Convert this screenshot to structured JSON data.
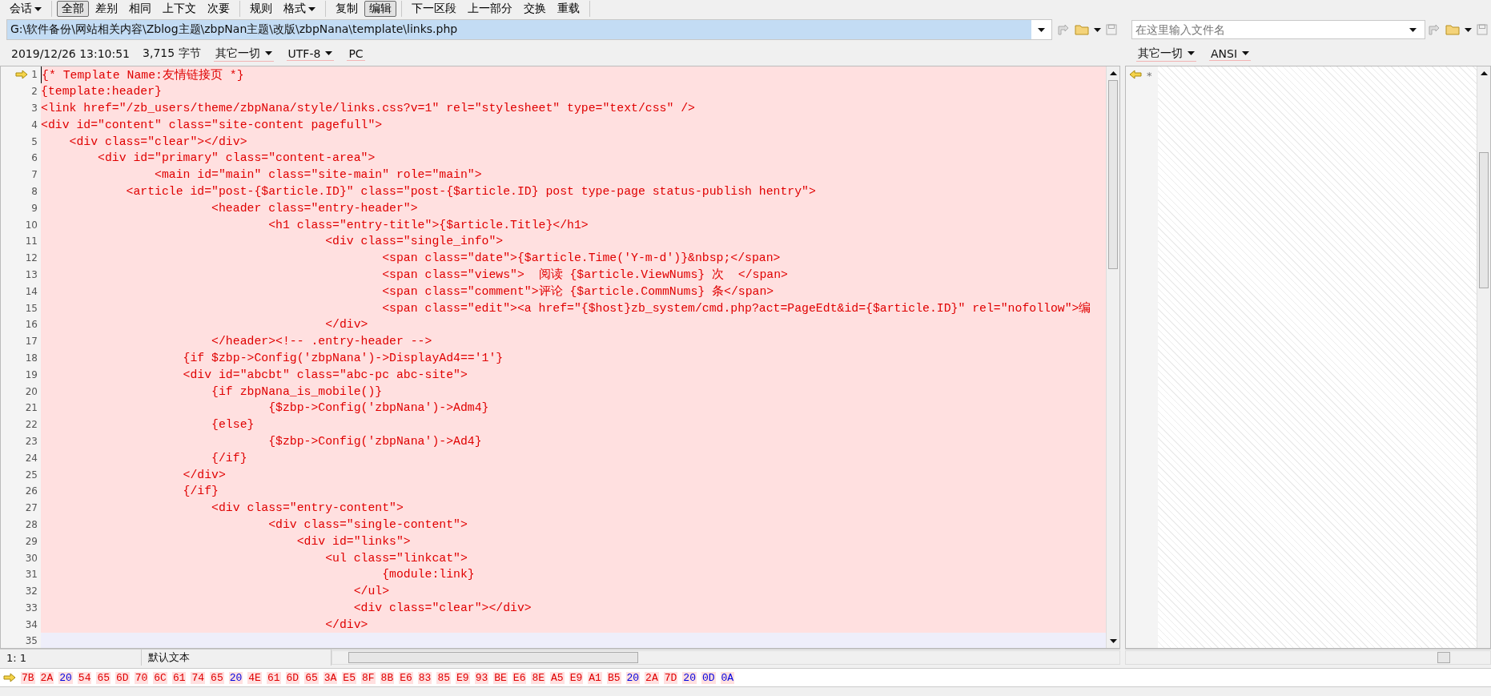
{
  "toolbar": {
    "groups": [
      [
        {
          "label": "会话",
          "pressed": false,
          "dropdown": true
        }
      ],
      [
        {
          "label": "全部",
          "pressed": true,
          "dropdown": false
        },
        {
          "label": "差别",
          "pressed": false,
          "dropdown": false
        },
        {
          "label": "相同",
          "pressed": false,
          "dropdown": false
        },
        {
          "label": "上下文",
          "pressed": false,
          "dropdown": false
        },
        {
          "label": "次要",
          "pressed": false,
          "dropdown": false
        }
      ],
      [
        {
          "label": "规则",
          "pressed": false,
          "dropdown": false
        },
        {
          "label": "格式",
          "pressed": false,
          "dropdown": true
        }
      ],
      [
        {
          "label": "复制",
          "pressed": false,
          "dropdown": false
        },
        {
          "label": "编辑",
          "pressed": true,
          "dropdown": false
        }
      ],
      [
        {
          "label": "下一区段",
          "pressed": false,
          "dropdown": false
        },
        {
          "label": "上一部分",
          "pressed": false,
          "dropdown": false
        },
        {
          "label": "交换",
          "pressed": false,
          "dropdown": false
        },
        {
          "label": "重载",
          "pressed": false,
          "dropdown": false
        }
      ]
    ]
  },
  "left": {
    "path": "G:\\软件备份\\网站相关内容\\Zblog主题\\zbpNan主题\\改版\\zbpNana\\template\\links.php",
    "timestamp": "2019/12/26 13:10:51",
    "size": "3,715 字节",
    "format": "其它一切",
    "encoding": "UTF-8",
    "line_ending": "PC",
    "lines": [
      {
        "number": "1",
        "text": "{* Template Name:友情链接页 *}",
        "kind": "changed",
        "current": true
      },
      {
        "number": "2",
        "text": "{template:header}",
        "kind": "changed",
        "current": false
      },
      {
        "number": "3",
        "text": "<link href=\"/zb_users/theme/zbpNana/style/links.css?v=1\" rel=\"stylesheet\" type=\"text/css\" />",
        "kind": "changed",
        "current": false
      },
      {
        "number": "4",
        "text": "<div id=\"content\" class=\"site-content pagefull\">",
        "kind": "changed",
        "current": false
      },
      {
        "number": "5",
        "text": "    <div class=\"clear\"></div>",
        "kind": "changed",
        "current": false
      },
      {
        "number": "6",
        "text": "        <div id=\"primary\" class=\"content-area\">",
        "kind": "changed",
        "current": false
      },
      {
        "number": "7",
        "text": "                <main id=\"main\" class=\"site-main\" role=\"main\">",
        "kind": "changed",
        "current": false
      },
      {
        "number": "8",
        "text": "            <article id=\"post-{$article.ID}\" class=\"post-{$article.ID} post type-page status-publish hentry\">",
        "kind": "changed",
        "current": false
      },
      {
        "number": "9",
        "text": "                        <header class=\"entry-header\">",
        "kind": "changed",
        "current": false
      },
      {
        "number": "10",
        "text": "                                <h1 class=\"entry-title\">{$article.Title}</h1>",
        "kind": "changed",
        "current": false
      },
      {
        "number": "11",
        "text": "                                        <div class=\"single_info\">",
        "kind": "changed",
        "current": false
      },
      {
        "number": "12",
        "text": "                                                <span class=\"date\">{$article.Time('Y-m-d')}&nbsp;</span>",
        "kind": "changed",
        "current": false
      },
      {
        "number": "13",
        "text": "                                                <span class=\"views\">  阅读 {$article.ViewNums} 次  </span>",
        "kind": "changed",
        "current": false
      },
      {
        "number": "14",
        "text": "                                                <span class=\"comment\">评论 {$article.CommNums} 条</span>",
        "kind": "changed",
        "current": false
      },
      {
        "number": "15",
        "text": "                                                <span class=\"edit\"><a href=\"{$host}zb_system/cmd.php?act=PageEdt&id={$article.ID}\" rel=\"nofollow\">编",
        "kind": "changed",
        "current": false
      },
      {
        "number": "16",
        "text": "                                        </div>",
        "kind": "changed",
        "current": false
      },
      {
        "number": "17",
        "text": "                        </header><!-- .entry-header -->",
        "kind": "changed",
        "current": false
      },
      {
        "number": "18",
        "text": "                    {if $zbp->Config('zbpNana')->DisplayAd4=='1'}",
        "kind": "changed",
        "current": false
      },
      {
        "number": "19",
        "text": "                    <div id=\"abcbt\" class=\"abc-pc abc-site\">",
        "kind": "changed",
        "current": false
      },
      {
        "number": "20",
        "text": "                        {if zbpNana_is_mobile()}",
        "kind": "changed",
        "current": false
      },
      {
        "number": "21",
        "text": "                                {$zbp->Config('zbpNana')->Adm4}",
        "kind": "changed",
        "current": false
      },
      {
        "number": "22",
        "text": "                        {else}",
        "kind": "changed",
        "current": false
      },
      {
        "number": "23",
        "text": "                                {$zbp->Config('zbpNana')->Ad4}",
        "kind": "changed",
        "current": false
      },
      {
        "number": "24",
        "text": "                        {/if}",
        "kind": "changed",
        "current": false
      },
      {
        "number": "25",
        "text": "                    </div>",
        "kind": "changed",
        "current": false
      },
      {
        "number": "26",
        "text": "                    {/if}",
        "kind": "changed",
        "current": false
      },
      {
        "number": "27",
        "text": "                        <div class=\"entry-content\">",
        "kind": "changed",
        "current": false
      },
      {
        "number": "28",
        "text": "                                <div class=\"single-content\">",
        "kind": "changed",
        "current": false
      },
      {
        "number": "29",
        "text": "                                    <div id=\"links\">",
        "kind": "changed",
        "current": false
      },
      {
        "number": "30",
        "text": "                                        <ul class=\"linkcat\">",
        "kind": "changed",
        "current": false
      },
      {
        "number": "31",
        "text": "                                                {module:link}",
        "kind": "changed",
        "current": false
      },
      {
        "number": "32",
        "text": "                                            </ul>",
        "kind": "changed",
        "current": false
      },
      {
        "number": "33",
        "text": "                                            <div class=\"clear\"></div>",
        "kind": "changed",
        "current": false
      },
      {
        "number": "34",
        "text": "                                        </div>",
        "kind": "changed",
        "current": false
      },
      {
        "number": "35",
        "kind": "blank",
        "current": false
      }
    ],
    "cursor_position": "1: 1",
    "syntax": "默认文本"
  },
  "right": {
    "placeholder": "在这里输入文件名",
    "format": "其它一切",
    "encoding": "ANSI",
    "marker": "*"
  },
  "hex_bytes": [
    {
      "text": "7B",
      "kind": "text"
    },
    {
      "text": "2A",
      "kind": "text"
    },
    {
      "text": "20",
      "kind": "whitespace"
    },
    {
      "text": "54",
      "kind": "text"
    },
    {
      "text": "65",
      "kind": "text"
    },
    {
      "text": "6D",
      "kind": "text"
    },
    {
      "text": "70",
      "kind": "text"
    },
    {
      "text": "6C",
      "kind": "text"
    },
    {
      "text": "61",
      "kind": "text"
    },
    {
      "text": "74",
      "kind": "text"
    },
    {
      "text": "65",
      "kind": "text"
    },
    {
      "text": "20",
      "kind": "whitespace"
    },
    {
      "text": "4E",
      "kind": "text"
    },
    {
      "text": "61",
      "kind": "text"
    },
    {
      "text": "6D",
      "kind": "text"
    },
    {
      "text": "65",
      "kind": "text"
    },
    {
      "text": "3A",
      "kind": "text"
    },
    {
      "text": "E5",
      "kind": "text"
    },
    {
      "text": "8F",
      "kind": "text"
    },
    {
      "text": "8B",
      "kind": "text"
    },
    {
      "text": "E6",
      "kind": "text"
    },
    {
      "text": "83",
      "kind": "text"
    },
    {
      "text": "85",
      "kind": "text"
    },
    {
      "text": "E9",
      "kind": "text"
    },
    {
      "text": "93",
      "kind": "text"
    },
    {
      "text": "BE",
      "kind": "text"
    },
    {
      "text": "E6",
      "kind": "text"
    },
    {
      "text": "8E",
      "kind": "text"
    },
    {
      "text": "A5",
      "kind": "text"
    },
    {
      "text": "E9",
      "kind": "text"
    },
    {
      "text": "A1",
      "kind": "text"
    },
    {
      "text": "B5",
      "kind": "text"
    },
    {
      "text": "20",
      "kind": "whitespace"
    },
    {
      "text": "2A",
      "kind": "text"
    },
    {
      "text": "7D",
      "kind": "text"
    },
    {
      "text": "20",
      "kind": "whitespace"
    },
    {
      "text": "0D",
      "kind": "whitespace"
    },
    {
      "text": "0A",
      "kind": "whitespace"
    }
  ]
}
